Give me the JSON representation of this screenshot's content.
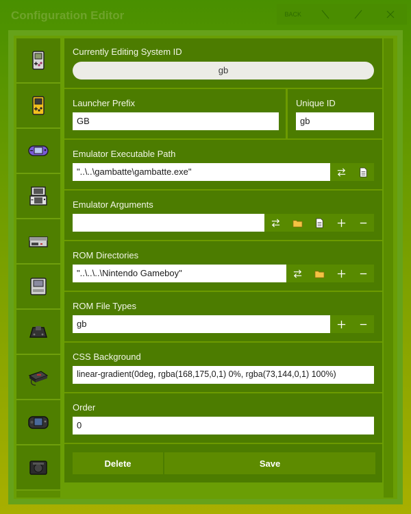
{
  "window": {
    "title": "Configuration Editor",
    "back_label": "BACK"
  },
  "sidebar": {
    "items": [
      {
        "icon": "gameboy-icon"
      },
      {
        "icon": "gameboy-color-icon"
      },
      {
        "icon": "gameboy-advance-icon"
      },
      {
        "icon": "nintendo-ds-icon"
      },
      {
        "icon": "nes-console-icon"
      },
      {
        "icon": "snes-console-icon"
      },
      {
        "icon": "n64-console-icon"
      },
      {
        "icon": "genesis-console-icon"
      },
      {
        "icon": "game-gear-icon"
      },
      {
        "icon": "sega-console-icon"
      }
    ]
  },
  "form": {
    "system_id": {
      "label": "Currently Editing System ID",
      "value": "gb"
    },
    "launcher_prefix": {
      "label": "Launcher Prefix",
      "value": "GB"
    },
    "unique_id": {
      "label": "Unique ID",
      "value": "gb"
    },
    "emulator_path": {
      "label": "Emulator Executable Path",
      "value": "\"..\\..\\gambatte\\gambatte.exe\""
    },
    "emulator_args": {
      "label": "Emulator Arguments",
      "value": ""
    },
    "rom_dirs": {
      "label": "ROM Directories",
      "value": "\"..\\..\\..\\Nintendo Gameboy\""
    },
    "rom_types": {
      "label": "ROM File Types",
      "value": "gb"
    },
    "css_background": {
      "label": "CSS Background",
      "value": "linear-gradient(0deg, rgba(168,175,0,1) 0%, rgba(73,144,0,1) 100%)"
    },
    "order": {
      "label": "Order",
      "value": "0"
    }
  },
  "actions": {
    "delete_label": "Delete",
    "save_label": "Save"
  },
  "colors": {
    "gradient_top": "#499000",
    "gradient_bottom": "#a8af00",
    "section_bg": "#4c7c00",
    "folder_icon": "#f4c242"
  }
}
